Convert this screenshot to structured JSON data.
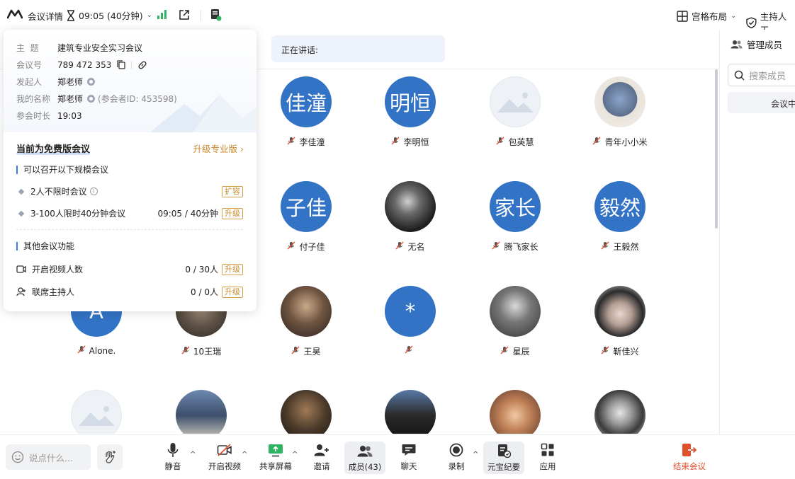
{
  "topbar": {
    "title": "会议详情",
    "timer": "09:05 (40分钟)",
    "layout_label": "宫格布局",
    "host_label": "主持人工"
  },
  "speaking": {
    "label": "正在讲话:"
  },
  "popup": {
    "rows": [
      {
        "key": "主  题",
        "value": "建筑专业安全实习会议"
      },
      {
        "key": "会议号",
        "value": "789 472 353"
      },
      {
        "key": "发起人",
        "value": "郑老师"
      },
      {
        "key": "我的名称",
        "value": "郑老师",
        "sub": "(参会者ID: 453598)"
      },
      {
        "key": "参会时长",
        "value": "19:03"
      }
    ],
    "free_title": "当前为免费版会议",
    "upgrade_link": "升级专业版",
    "section1_title": "可以召开以下规模会议",
    "feature1_label": "2人不限时会议",
    "feature1_tag": "扩容",
    "feature2_label": "3-100人限时40分钟会议",
    "feature2_value": "09:05 / 40分钟",
    "feature2_tag": "升级",
    "section2_title": "其他会议功能",
    "feature3_label": "开启视频人数",
    "feature3_value": "0 / 30人",
    "feature3_tag": "升级",
    "feature4_label": "联席主持人",
    "feature4_value": "0 / 0人",
    "feature4_tag": "升级"
  },
  "participants": [
    {
      "name": "李佳潼",
      "avatar_text": "佳潼",
      "kind": "blue"
    },
    {
      "name": "李明恒",
      "avatar_text": "明恒",
      "kind": "blue"
    },
    {
      "name": "包英慧",
      "avatar_text": "",
      "kind": "placeholder"
    },
    {
      "name": "青年小小米",
      "avatar_text": "",
      "kind": "photo"
    },
    {
      "name": "付子佳",
      "avatar_text": "子佳",
      "kind": "blue"
    },
    {
      "name": "无名",
      "avatar_text": "",
      "kind": "photo"
    },
    {
      "name": "腾飞家长",
      "avatar_text": "家长",
      "kind": "blue"
    },
    {
      "name": "王毅然",
      "avatar_text": "毅然",
      "kind": "blue"
    },
    {
      "name": "Alone.",
      "avatar_text": "A",
      "kind": "blue"
    },
    {
      "name": "10王瑞",
      "avatar_text": "",
      "kind": "photo"
    },
    {
      "name": "王昊",
      "avatar_text": "",
      "kind": "photo"
    },
    {
      "name": "",
      "avatar_text": "*",
      "kind": "blue"
    },
    {
      "name": "星辰",
      "avatar_text": "",
      "kind": "photo"
    },
    {
      "name": "靳佳兴",
      "avatar_text": "",
      "kind": "photo"
    }
  ],
  "right_panel": {
    "title": "管理成员",
    "search_placeholder": "搜索成员",
    "tab_label": "会议中"
  },
  "bottombar": {
    "chat_placeholder": "说点什么...",
    "tools": {
      "mute": "静音",
      "video": "开启视频",
      "share": "共享屏幕",
      "invite": "邀请",
      "members": "成员(43)",
      "chat": "聊天",
      "record": "录制",
      "minutes": "元宝纪要",
      "apps": "应用",
      "end": "结束会议"
    }
  },
  "colors": {
    "avatar_blue": "#3273c5",
    "upgrade_gold": "#c98a2b",
    "end_red": "#e0502d",
    "accent_blue": "#3f7fe0"
  }
}
